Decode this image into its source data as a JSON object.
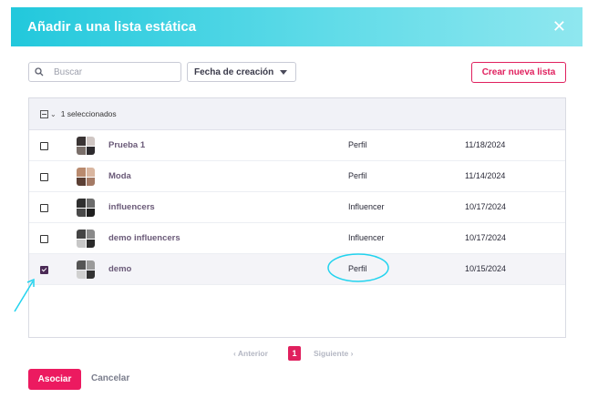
{
  "dialog": {
    "title": "Añadir a una lista estática",
    "close_icon": "close-icon"
  },
  "toolbar": {
    "search_placeholder": "Buscar",
    "search_value": "",
    "sort_label": "Fecha de creación",
    "create_label": "Crear nueva lista"
  },
  "table": {
    "selected_label": "1 seleccionados",
    "rows": [
      {
        "name": "Prueba 1",
        "type": "Perfil",
        "date": "11/18/2024",
        "checked": false
      },
      {
        "name": "Moda",
        "type": "Perfil",
        "date": "11/14/2024",
        "checked": false
      },
      {
        "name": "influencers",
        "type": "Influencer",
        "date": "10/17/2024",
        "checked": false
      },
      {
        "name": "demo influencers",
        "type": "Influencer",
        "date": "10/17/2024",
        "checked": false
      },
      {
        "name": "demo",
        "type": "Perfil",
        "date": "10/15/2024",
        "checked": true
      }
    ]
  },
  "pagination": {
    "prev_label": "‹ Anterior",
    "current_page": "1",
    "next_label": "Siguiente ›"
  },
  "footer": {
    "submit_label": "Asociar",
    "cancel_label": "Cancelar"
  },
  "colors": {
    "accent": "#e0205e",
    "header_start": "#22c8dc",
    "header_end": "#8fe7ef",
    "annotation": "#22d3ee"
  }
}
